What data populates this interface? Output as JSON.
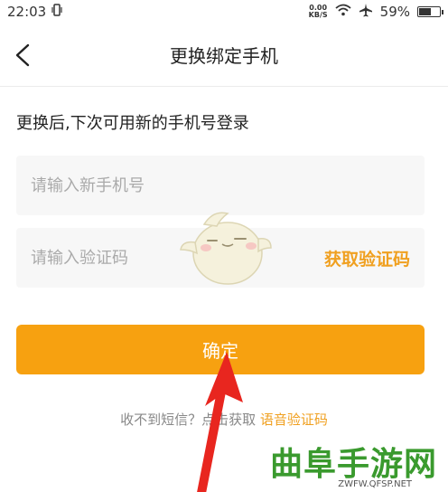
{
  "status_bar": {
    "time": "22:03",
    "net_speed_value": "0.00",
    "net_speed_unit": "KB/S",
    "battery": "59%",
    "battery_level": 0.59
  },
  "nav": {
    "title": "更换绑定手机"
  },
  "hint": "更换后,下次可用新的手机号登录",
  "form": {
    "phone_placeholder": "请输入新手机号",
    "code_placeholder": "请输入验证码",
    "get_code_label": "获取验证码"
  },
  "confirm_label": "确定",
  "footer": {
    "tip_text": "收不到短信？点击获取",
    "voice_link": "语音验证码"
  },
  "watermark": {
    "title": "曲阜手游网",
    "domain": "ZWFW.QFSP.NET"
  },
  "colors": {
    "accent": "#f7a110",
    "link": "#f0a020",
    "arrow": "#e8261f"
  }
}
